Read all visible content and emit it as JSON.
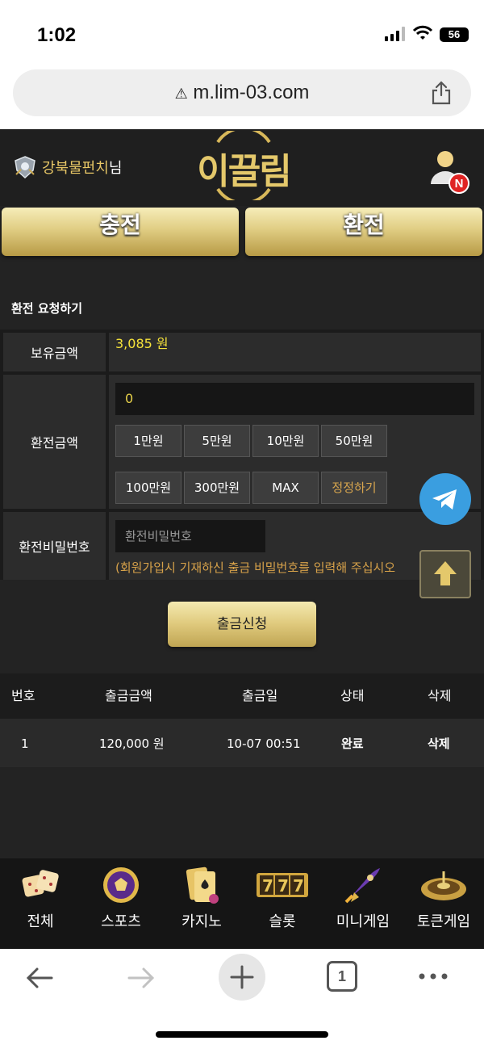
{
  "status_bar": {
    "time": "1:02",
    "battery": "56"
  },
  "browser": {
    "url": "m.lim-03.com",
    "tab_count": "1"
  },
  "header": {
    "username": "강북물펀치",
    "username_suffix": "님",
    "logo_text": "이끌림",
    "notification_badge": "N"
  },
  "main_tabs": {
    "charge": "충전",
    "exchange": "환전"
  },
  "form": {
    "section_title": "환전 요청하기",
    "balance_label": "보유금액",
    "balance_value": "3,085 원",
    "amount_label": "환전금액",
    "amount_value": "0",
    "quick_amounts": [
      "1만원",
      "5만원",
      "10만원",
      "50만원",
      "100만원",
      "300만원",
      "MAX"
    ],
    "reset_label": "정정하기",
    "password_label": "환전비밀번호",
    "password_placeholder": "환전비밀번호",
    "password_hint": "(회원가입시 기재하신 출금 비밀번호를 입력해 주십시오",
    "submit_label": "출금신청"
  },
  "history": {
    "columns": [
      "번호",
      "출금금액",
      "출금일",
      "상태",
      "삭제"
    ],
    "rows": [
      {
        "no": "1",
        "amount": "120,000 원",
        "date": "10-07 00:51",
        "status": "완료",
        "delete": "삭제"
      }
    ]
  },
  "bottom_nav": [
    {
      "label": "전체",
      "icon": "dice-icon"
    },
    {
      "label": "스포츠",
      "icon": "soccer-ball-icon"
    },
    {
      "label": "카지노",
      "icon": "playing-cards-icon"
    },
    {
      "label": "슬롯",
      "icon": "slot-777-icon"
    },
    {
      "label": "미니게임",
      "icon": "rocket-icon"
    },
    {
      "label": "토큰게임",
      "icon": "roulette-icon"
    }
  ],
  "colors": {
    "gold": "#e4c86b",
    "balance_yellow": "#f5e23a",
    "hint_orange": "#d7a24a",
    "telegram_blue": "#3a9ee0",
    "badge_red": "#e02424"
  }
}
